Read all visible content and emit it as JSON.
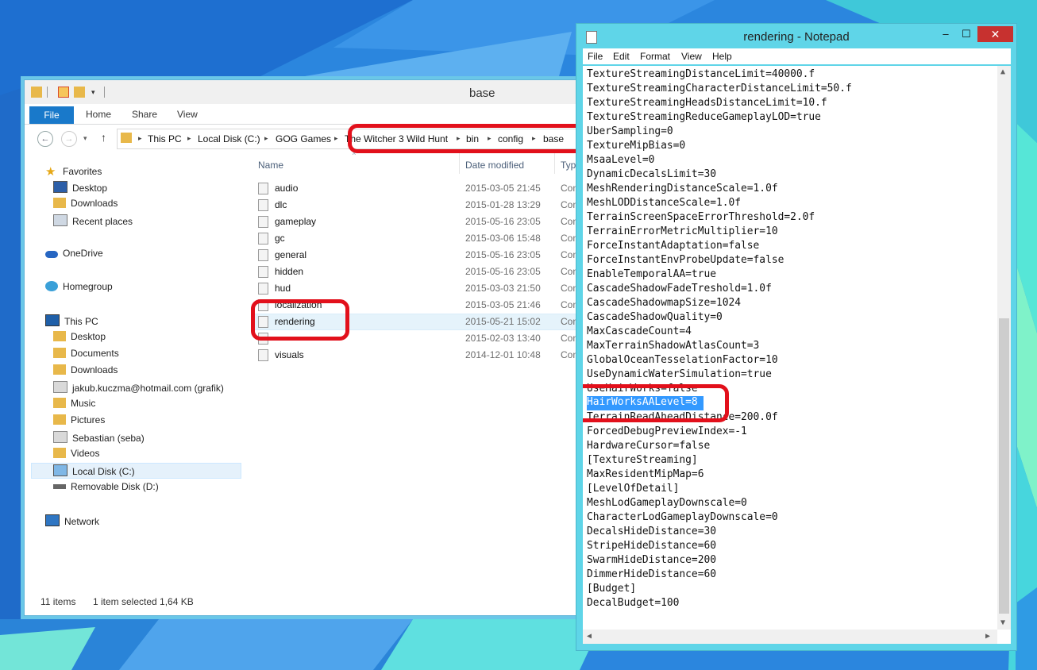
{
  "explorer": {
    "title": "base",
    "tabs": [
      "File",
      "Home",
      "Share",
      "View"
    ],
    "breadcrumb": [
      "This PC",
      "Local Disk (C:)",
      "GOG Games",
      "The Witcher 3 Wild Hunt",
      "bin",
      "config",
      "base"
    ],
    "columns": {
      "name": "Name",
      "date": "Date modified",
      "type": "Typ"
    },
    "nav": {
      "favorites": "Favorites",
      "fav_items": [
        "Desktop",
        "Downloads",
        "Recent places"
      ],
      "onedrive": "OneDrive",
      "homegroup": "Homegroup",
      "thispc": "This PC",
      "pc_items": [
        "Desktop",
        "Documents",
        "Downloads",
        "jakub.kuczma@hotmail.com (grafik)",
        "Music",
        "Pictures",
        "Sebastian (seba)",
        "Videos",
        "Local Disk (C:)",
        "Removable Disk (D:)"
      ],
      "network": "Network"
    },
    "files": [
      {
        "name": "audio",
        "date": "2015-03-05 21:45",
        "type": "Con"
      },
      {
        "name": "dlc",
        "date": "2015-01-28 13:29",
        "type": "Con"
      },
      {
        "name": "gameplay",
        "date": "2015-05-16 23:05",
        "type": "Con"
      },
      {
        "name": "gc",
        "date": "2015-03-06 15:48",
        "type": "Con"
      },
      {
        "name": "general",
        "date": "2015-05-16 23:05",
        "type": "Con"
      },
      {
        "name": "hidden",
        "date": "2015-05-16 23:05",
        "type": "Con"
      },
      {
        "name": "hud",
        "date": "2015-03-03 21:50",
        "type": "Con"
      },
      {
        "name": "localization",
        "date": "2015-03-05 21:46",
        "type": "Con"
      },
      {
        "name": "rendering",
        "date": "2015-05-21 15:02",
        "type": "Con"
      },
      {
        "name": "",
        "date": "2015-02-03 13:40",
        "type": "Con"
      },
      {
        "name": "visuals",
        "date": "2014-12-01 10:48",
        "type": "Con"
      }
    ],
    "status": {
      "count": "11 items",
      "selected": "1 item selected  1,64 KB"
    }
  },
  "notepad": {
    "title": "rendering - Notepad",
    "menu": [
      "File",
      "Edit",
      "Format",
      "View",
      "Help"
    ],
    "lines": [
      "TextureStreamingDistanceLimit=40000.f",
      "TextureStreamingCharacterDistanceLimit=50.f",
      "TextureStreamingHeadsDistanceLimit=10.f",
      "TextureStreamingReduceGameplayLOD=true",
      "UberSampling=0",
      "TextureMipBias=0",
      "MsaaLevel=0",
      "DynamicDecalsLimit=30",
      "MeshRenderingDistanceScale=1.0f",
      "MeshLODDistanceScale=1.0f",
      "TerrainScreenSpaceErrorThreshold=2.0f",
      "TerrainErrorMetricMultiplier=10",
      "ForceInstantAdaptation=false",
      "ForceInstantEnvProbeUpdate=false",
      "EnableTemporalAA=true",
      "CascadeShadowFadeTreshold=1.0f",
      "CascadeShadowmapSize=1024",
      "CascadeShadowQuality=0",
      "MaxCascadeCount=4",
      "MaxTerrainShadowAtlasCount=3",
      "GlobalOceanTesselationFactor=10",
      "UseDynamicWaterSimulation=true",
      "UseHairWorks=false",
      "",
      "TerrainReadAheadDistance=200.0f",
      "ForcedDebugPreviewIndex=-1",
      "HardwareCursor=false",
      "[TextureStreaming]",
      "MaxResidentMipMap=6",
      "[LevelOfDetail]",
      "MeshLodGameplayDownscale=0",
      "CharacterLodGameplayDownscale=0",
      "DecalsHideDistance=30",
      "StripeHideDistance=60",
      "SwarmHideDistance=200",
      "DimmerHideDistance=60",
      "[Budget]",
      "DecalBudget=100"
    ],
    "selected_line": "HairWorksAALevel=8"
  },
  "colors": {
    "highlight": "#e2101b",
    "selection": "#3399ff",
    "window_border": "#5fd5e8"
  }
}
